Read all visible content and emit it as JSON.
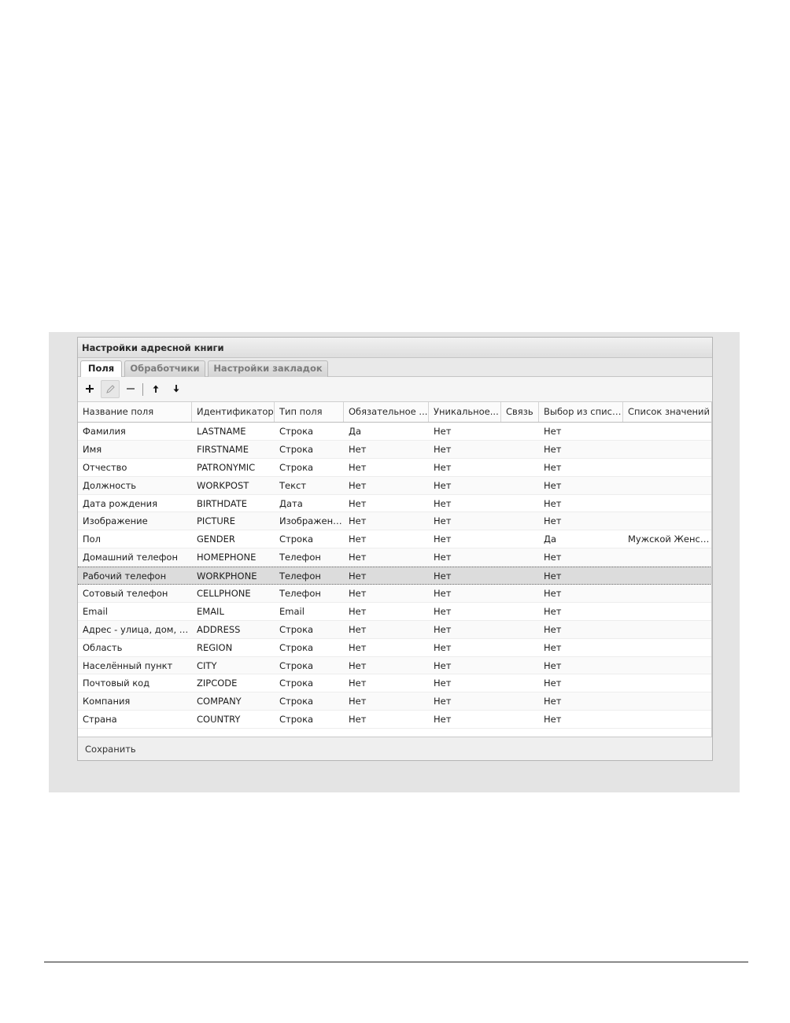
{
  "window": {
    "title": "Настройки адресной книги",
    "save_label": "Сохранить"
  },
  "tabs": [
    {
      "label": "Поля",
      "active": true
    },
    {
      "label": "Обработчики",
      "active": false
    },
    {
      "label": "Настройки закладок",
      "active": false
    }
  ],
  "toolbar": {
    "buttons": [
      {
        "name": "add-button",
        "icon": "plus-icon",
        "glyph": "+"
      },
      {
        "name": "edit-button",
        "icon": "pencil-icon",
        "glyph": "✎"
      },
      {
        "name": "remove-button",
        "icon": "minus-icon",
        "glyph": "−"
      },
      {
        "name": "move-up-button",
        "icon": "arrow-up-icon",
        "glyph": "↑"
      },
      {
        "name": "move-down-button",
        "icon": "arrow-down-icon",
        "glyph": "↓"
      }
    ]
  },
  "grid": {
    "columns": [
      "Название поля",
      "Идентификатор",
      "Тип поля",
      "Обязательное ...",
      "Уникальное...",
      "Связь",
      "Выбор из списка",
      "Список значений"
    ],
    "selected_row": 8,
    "rows": [
      [
        "Фамилия",
        "LASTNAME",
        "Строка",
        "Да",
        "Нет",
        "",
        "Нет",
        ""
      ],
      [
        "Имя",
        "FIRSTNAME",
        "Строка",
        "Нет",
        "Нет",
        "",
        "Нет",
        ""
      ],
      [
        "Отчество",
        "PATRONYMIC",
        "Строка",
        "Нет",
        "Нет",
        "",
        "Нет",
        ""
      ],
      [
        "Должность",
        "WORKPOST",
        "Текст",
        "Нет",
        "Нет",
        "",
        "Нет",
        ""
      ],
      [
        "Дата рождения",
        "BIRTHDATE",
        "Дата",
        "Нет",
        "Нет",
        "",
        "Нет",
        ""
      ],
      [
        "Изображение",
        "PICTURE",
        "Изображение",
        "Нет",
        "Нет",
        "",
        "Нет",
        ""
      ],
      [
        "Пол",
        "GENDER",
        "Строка",
        "Нет",
        "Нет",
        "",
        "Да",
        "Мужской Женск..."
      ],
      [
        "Домашний телефон",
        "HOMEPHONE",
        "Телефон",
        "Нет",
        "Нет",
        "",
        "Нет",
        ""
      ],
      [
        "Рабочий телефон",
        "WORKPHONE",
        "Телефон",
        "Нет",
        "Нет",
        "",
        "Нет",
        ""
      ],
      [
        "Сотовый телефон",
        "CELLPHONE",
        "Телефон",
        "Нет",
        "Нет",
        "",
        "Нет",
        ""
      ],
      [
        "Email",
        "EMAIL",
        "Email",
        "Нет",
        "Нет",
        "",
        "Нет",
        ""
      ],
      [
        "Адрес - улица, дом, кв.",
        "ADDRESS",
        "Строка",
        "Нет",
        "Нет",
        "",
        "Нет",
        ""
      ],
      [
        "Область",
        "REGION",
        "Строка",
        "Нет",
        "Нет",
        "",
        "Нет",
        ""
      ],
      [
        "Населённый пункт",
        "CITY",
        "Строка",
        "Нет",
        "Нет",
        "",
        "Нет",
        ""
      ],
      [
        "Почтовый код",
        "ZIPCODE",
        "Строка",
        "Нет",
        "Нет",
        "",
        "Нет",
        ""
      ],
      [
        "Компания",
        "COMPANY",
        "Строка",
        "Нет",
        "Нет",
        "",
        "Нет",
        ""
      ],
      [
        "Страна",
        "COUNTRY",
        "Строка",
        "Нет",
        "Нет",
        "",
        "Нет",
        ""
      ]
    ]
  }
}
